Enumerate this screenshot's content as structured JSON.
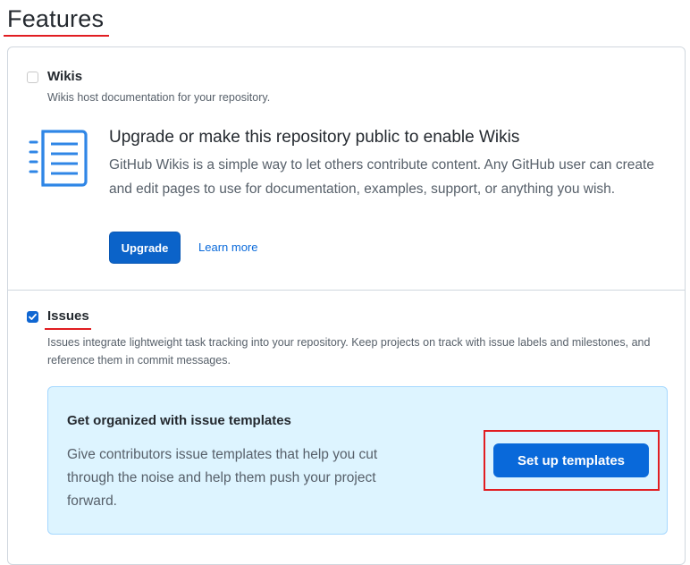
{
  "heading": "Features",
  "wikis": {
    "label": "Wikis",
    "checked": false,
    "description": "Wikis host documentation for your repository.",
    "icon": "wiki-document-icon",
    "upgrade_title": "Upgrade or make this repository public to enable Wikis",
    "upgrade_text": "GitHub Wikis is a simple way to let others contribute content. Any GitHub user can create and edit pages to use for documentation, examples, support, or anything you wish.",
    "upgrade_button": "Upgrade",
    "learn_more": "Learn more"
  },
  "issues": {
    "label": "Issues",
    "checked": true,
    "description": "Issues integrate lightweight task tracking into your repository. Keep projects on track with issue labels and milestones, and reference them in commit messages.",
    "templates_title": "Get organized with issue templates",
    "templates_text": "Give contributors issue templates that help you cut through the noise and help them push your project forward.",
    "templates_button": "Set up templates"
  },
  "colors": {
    "accent": "#0969da",
    "annotation_red": "#e11d21",
    "callout_bg": "#ddf4ff"
  }
}
